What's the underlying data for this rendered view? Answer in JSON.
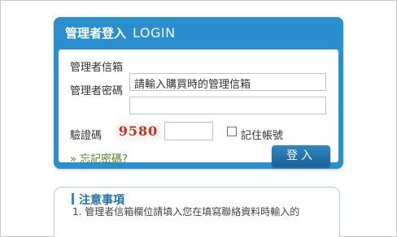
{
  "login": {
    "title": "管理者登入",
    "title_en": "LOGIN",
    "email_label": "管理者信箱",
    "email_value": "請輸入購買時的管理信箱",
    "password_label": "管理者密碼",
    "password_value": "",
    "captcha_label": "驗證碼",
    "captcha_code": "9580",
    "captcha_input_value": "",
    "remember_label": "記住帳號",
    "remember_checked": false,
    "forgot_link": "» 忘記密碼?",
    "submit_label": "登入"
  },
  "notice": {
    "title": "注意事項",
    "line1": "1. 管理者信箱欄位請填入您在填寫聯絡資料時輸入的"
  },
  "colors": {
    "panel_blue": "#2b8fcf",
    "button_blue": "#1f6fa8",
    "link_green": "#4b8a1f",
    "captcha_red": "#d42a1c"
  }
}
